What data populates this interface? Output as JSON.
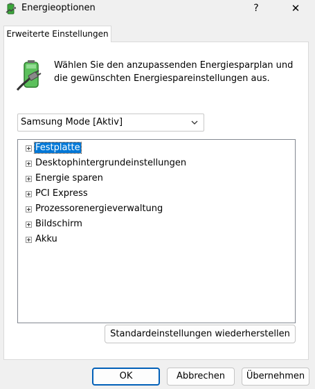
{
  "window": {
    "title": "Energieoptionen",
    "help_label": "?",
    "close_label": "✕"
  },
  "tab": {
    "label": "Erweiterte Einstellungen"
  },
  "description": "Wählen Sie den anzupassenden Energiesparplan und die gewünschten Energiespareinstellungen aus.",
  "plan_select": {
    "value": "Samsung Mode [Aktiv]"
  },
  "tree": {
    "items": [
      {
        "label": "Festplatte",
        "selected": true
      },
      {
        "label": "Desktophintergrundeinstellungen"
      },
      {
        "label": "Energie sparen"
      },
      {
        "label": "PCI Express"
      },
      {
        "label": "Prozessorenergieverwaltung"
      },
      {
        "label": "Bildschirm"
      },
      {
        "label": "Akku"
      }
    ]
  },
  "buttons": {
    "restore": "Standardeinstellungen wiederherstellen",
    "ok": "OK",
    "cancel": "Abbrechen",
    "apply": "Übernehmen"
  }
}
